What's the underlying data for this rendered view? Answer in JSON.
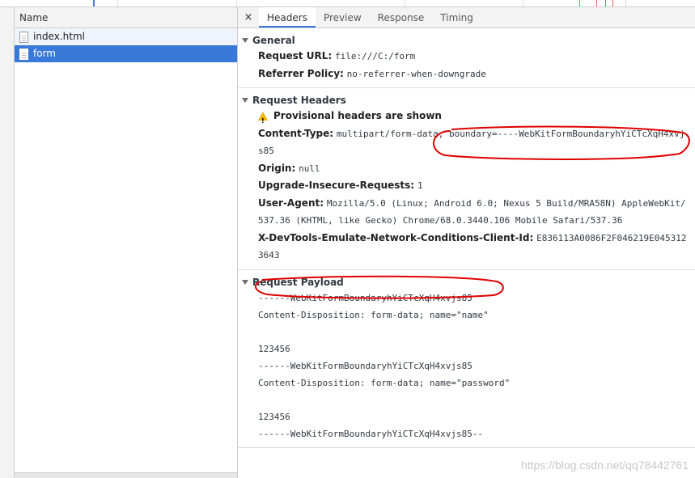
{
  "request_list": {
    "column_header": "Name",
    "items": [
      {
        "name": "index.html",
        "selected": false
      },
      {
        "name": "form",
        "selected": true
      }
    ]
  },
  "tabs": {
    "close": "×",
    "items": [
      "Headers",
      "Preview",
      "Response",
      "Timing"
    ],
    "active": "Headers"
  },
  "general": {
    "title": "General",
    "rows": [
      {
        "key": "Request URL:",
        "value": "file:///C:/form"
      },
      {
        "key": "Referrer Policy:",
        "value": "no-referrer-when-downgrade"
      }
    ]
  },
  "request_headers": {
    "title": "Request Headers",
    "provisional": "Provisional headers are shown",
    "rows": [
      {
        "key": "Content-Type:",
        "value": "multipart/form-data; boundary=----WebKitFormBoundaryhYiCTcXqH4xvjs85"
      },
      {
        "key": "Origin:",
        "value": "null"
      },
      {
        "key": "Upgrade-Insecure-Requests:",
        "value": "1"
      },
      {
        "key": "User-Agent:",
        "value": "Mozilla/5.0 (Linux; Android 6.0; Nexus 5 Build/MRA58N) AppleWebKit/537.36 (KHTML, like Gecko) Chrome/68.0.3440.106 Mobile Safari/537.36"
      },
      {
        "key": "X-DevTools-Emulate-Network-Conditions-Client-Id:",
        "value": "E836113A0086F2F046219E0453123643"
      }
    ]
  },
  "request_payload": {
    "title": "Request Payload",
    "lines": [
      "------WebKitFormBoundaryhYiCTcXqH4xvjs85",
      "Content-Disposition: form-data; name=\"name\"",
      "",
      "123456",
      "------WebKitFormBoundaryhYiCTcXqH4xvjs85",
      "Content-Disposition: form-data; name=\"password\"",
      "",
      "123456",
      "------WebKitFormBoundaryhYiCTcXqH4xvjs85--"
    ]
  },
  "watermark": "https://blog.csdn.net/qq78442761",
  "colors": {
    "accent": "#3879d9",
    "annotation": "#e00000",
    "warning": "#f4b400"
  }
}
